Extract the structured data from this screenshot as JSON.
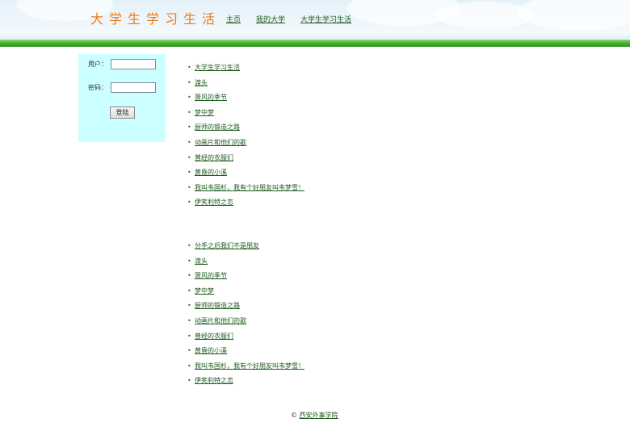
{
  "header": {
    "site_title": "大学生学习生活",
    "nav": [
      {
        "label": "主页"
      },
      {
        "label": "我的大学"
      },
      {
        "label": "大学生学习生活"
      }
    ]
  },
  "login": {
    "user_label": "用户：",
    "user_value": "",
    "password_label": "密码：",
    "password_value": "",
    "submit_label": "登陆"
  },
  "list_one": [
    {
      "label": "大学生学习生活"
    },
    {
      "label": "渡头"
    },
    {
      "label": "箫风的季节"
    },
    {
      "label": "梦中梦"
    },
    {
      "label": "厨师的锻造之路"
    },
    {
      "label": "动画片和他们的歌"
    },
    {
      "label": "曾经的衣服们"
    },
    {
      "label": "黄昏的小溪"
    },
    {
      "label": "我叫韦国杉，我有个好朋友叫韦梦雪！"
    },
    {
      "label": "伊笑利特之恋"
    }
  ],
  "list_two": [
    {
      "label": "分手之后我们不是朋友"
    },
    {
      "label": "渡头"
    },
    {
      "label": "箫风的季节"
    },
    {
      "label": "梦中梦"
    },
    {
      "label": "厨师的锻造之路"
    },
    {
      "label": "动画片和他们的歌"
    },
    {
      "label": "曾经的衣服们"
    },
    {
      "label": "黄昏的小溪"
    },
    {
      "label": "我叫韦国杉，我有个好朋友叫韦梦雪！"
    },
    {
      "label": "伊笑利特之恋"
    }
  ],
  "footer": {
    "copyright_symbol": "©",
    "link_label": "西安外事学院"
  },
  "colors": {
    "title_orange": "#ee7a12",
    "link_green": "#1e5a1e",
    "login_panel_bg": "#ccffff",
    "header_green": "#4ab033"
  },
  "icons": {
    "bullet": "bullet-icon"
  }
}
